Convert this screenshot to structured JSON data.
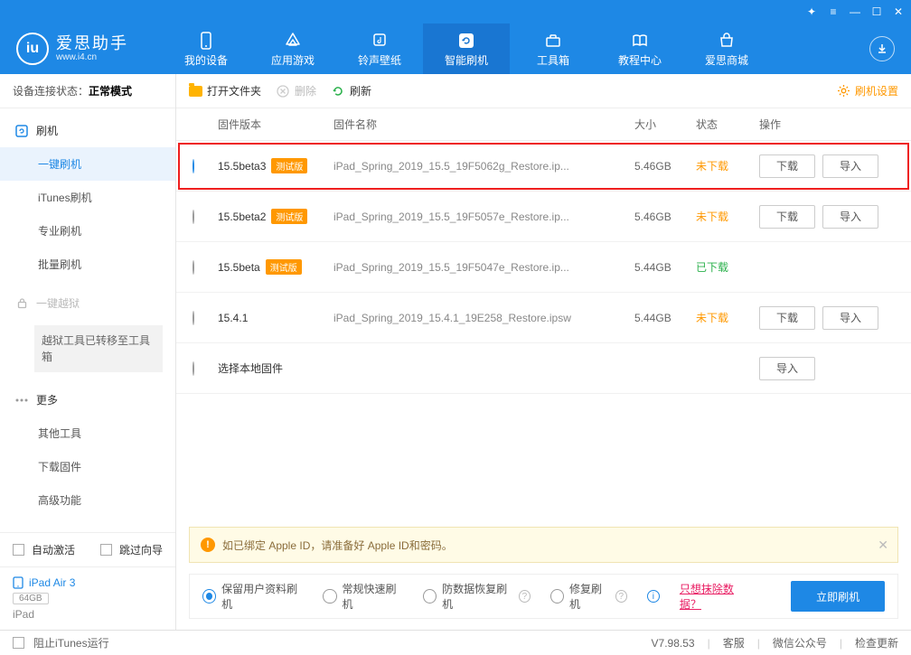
{
  "titlebar_icons": [
    "gift",
    "menu",
    "min",
    "max",
    "close"
  ],
  "logo": {
    "main": "爱思助手",
    "sub": "www.i4.cn",
    "badge": "iu"
  },
  "nav": [
    {
      "id": "device",
      "label": "我的设备"
    },
    {
      "id": "apps",
      "label": "应用游戏"
    },
    {
      "id": "ringtone",
      "label": "铃声壁纸"
    },
    {
      "id": "flash",
      "label": "智能刷机",
      "active": true
    },
    {
      "id": "toolbox",
      "label": "工具箱"
    },
    {
      "id": "tutorial",
      "label": "教程中心"
    },
    {
      "id": "mall",
      "label": "爱思商城"
    }
  ],
  "sidebar": {
    "conn_label": "设备连接状态：",
    "conn_value": "正常模式",
    "s1_title": "刷机",
    "s1_items": [
      "一键刷机",
      "iTunes刷机",
      "专业刷机",
      "批量刷机"
    ],
    "s2_title": "一键越狱",
    "s2_note": "越狱工具已转移至工具箱",
    "s3_title": "更多",
    "s3_items": [
      "其他工具",
      "下载固件",
      "高级功能"
    ],
    "auto_activate": "自动激活",
    "skip_guide": "跳过向导",
    "device_name": "iPad Air 3",
    "device_cap": "64GB",
    "device_type": "iPad"
  },
  "toolbar": {
    "open_folder": "打开文件夹",
    "delete": "删除",
    "refresh": "刷新",
    "settings": "刷机设置"
  },
  "table": {
    "headers": {
      "version": "固件版本",
      "name": "固件名称",
      "size": "大小",
      "status": "状态",
      "ops": "操作"
    },
    "download": "下载",
    "import": "导入",
    "local_firmware": "选择本地固件",
    "rows": [
      {
        "version": "15.5beta3",
        "beta": "测试版",
        "name": "iPad_Spring_2019_15.5_19F5062g_Restore.ip...",
        "size": "5.46GB",
        "status": "未下载",
        "status_class": "pending",
        "selected": true,
        "highlight": true,
        "can_download": true
      },
      {
        "version": "15.5beta2",
        "beta": "测试版",
        "name": "iPad_Spring_2019_15.5_19F5057e_Restore.ip...",
        "size": "5.46GB",
        "status": "未下载",
        "status_class": "pending",
        "can_download": true
      },
      {
        "version": "15.5beta",
        "beta": "测试版",
        "name": "iPad_Spring_2019_15.5_19F5047e_Restore.ip...",
        "size": "5.44GB",
        "status": "已下载",
        "status_class": "done",
        "can_download": false
      },
      {
        "version": "15.4.1",
        "beta": "",
        "name": "iPad_Spring_2019_15.4.1_19E258_Restore.ipsw",
        "size": "5.44GB",
        "status": "未下载",
        "status_class": "pending",
        "can_download": true
      }
    ]
  },
  "warning": "如已绑定 Apple ID，请准备好 Apple ID和密码。",
  "options": {
    "o1": "保留用户资料刷机",
    "o2": "常规快速刷机",
    "o3": "防数据恢复刷机",
    "o4": "修复刷机",
    "erase_link": "只想抹除数据？",
    "primary": "立即刷机"
  },
  "statusbar": {
    "block_itunes": "阻止iTunes运行",
    "version": "V7.98.53",
    "support": "客服",
    "wechat": "微信公众号",
    "update": "检查更新"
  }
}
